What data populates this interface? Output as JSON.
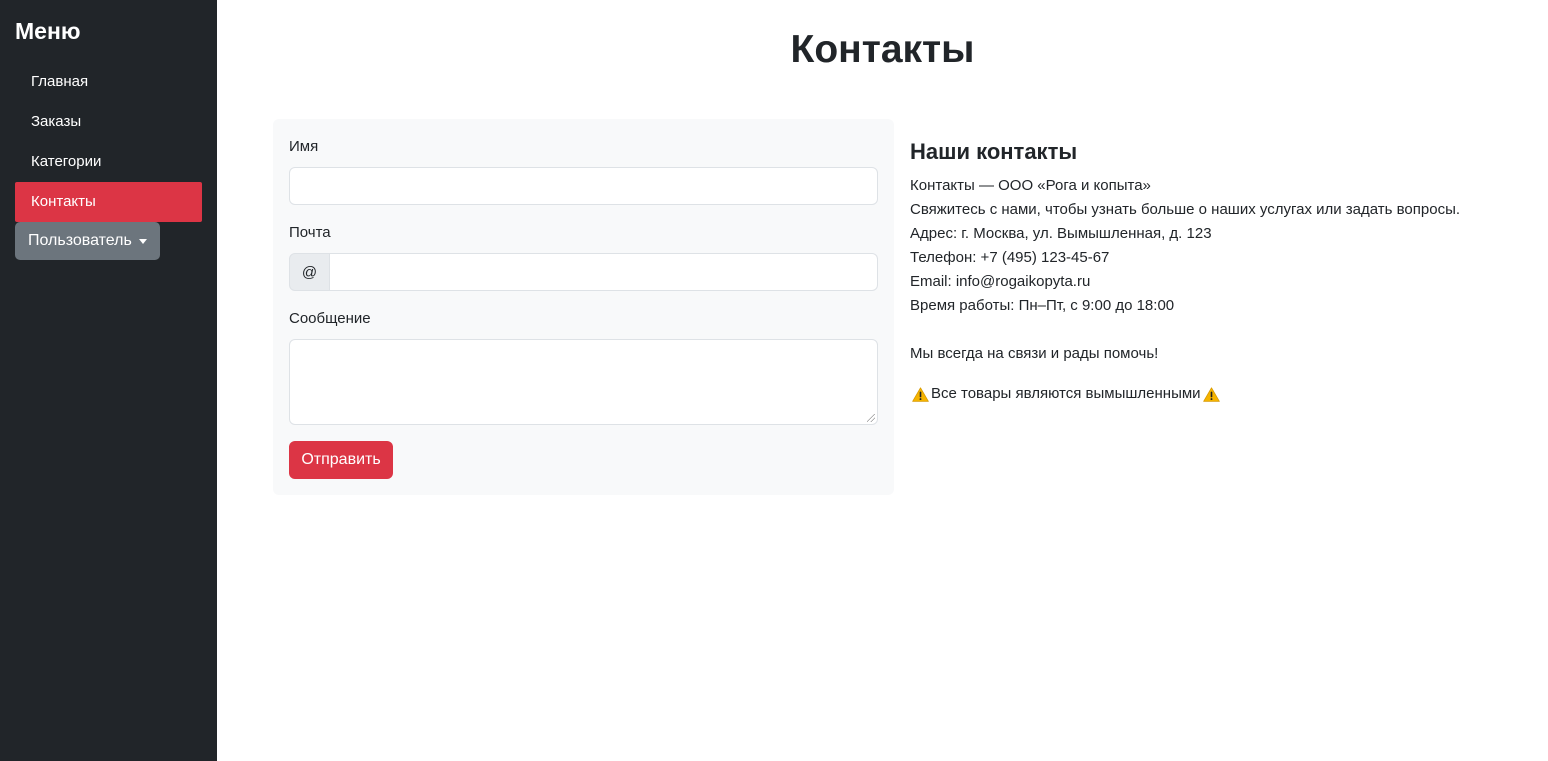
{
  "sidebar": {
    "title": "Меню",
    "items": [
      {
        "label": "Главная",
        "active": false
      },
      {
        "label": "Заказы",
        "active": false
      },
      {
        "label": "Категории",
        "active": false
      },
      {
        "label": "Контакты",
        "active": true
      }
    ],
    "user_button": "Пользователь"
  },
  "page": {
    "title": "Контакты"
  },
  "form": {
    "name_label": "Имя",
    "name_value": "",
    "email_label": "Почта",
    "email_prefix": "@",
    "email_value": "",
    "message_label": "Сообщение",
    "message_value": "",
    "submit_label": "Отправить"
  },
  "contacts": {
    "heading": "Наши контакты",
    "company": "Контакты — ООО «Рога и копыта»",
    "intro": "Свяжитесь с нами, чтобы узнать больше о наших услугах или задать вопросы.",
    "address": "Адрес: г. Москва, ул. Вымышленная, д. 123",
    "phone": "Телефон: +7 (495) 123-45-67",
    "email": "Email: info@rogaikopyta.ru",
    "hours": "Время работы: Пн–Пт, с 9:00 до 18:00",
    "closing": "Мы всегда на связи и рады помочь!",
    "disclaimer": "Все товары являются вымышленными",
    "disclaimer_icon": "warning-icon"
  },
  "colors": {
    "sidebar_bg": "#212529",
    "accent": "#dc3545",
    "secondary": "#6c757d",
    "form_bg": "#f8f9fa"
  }
}
